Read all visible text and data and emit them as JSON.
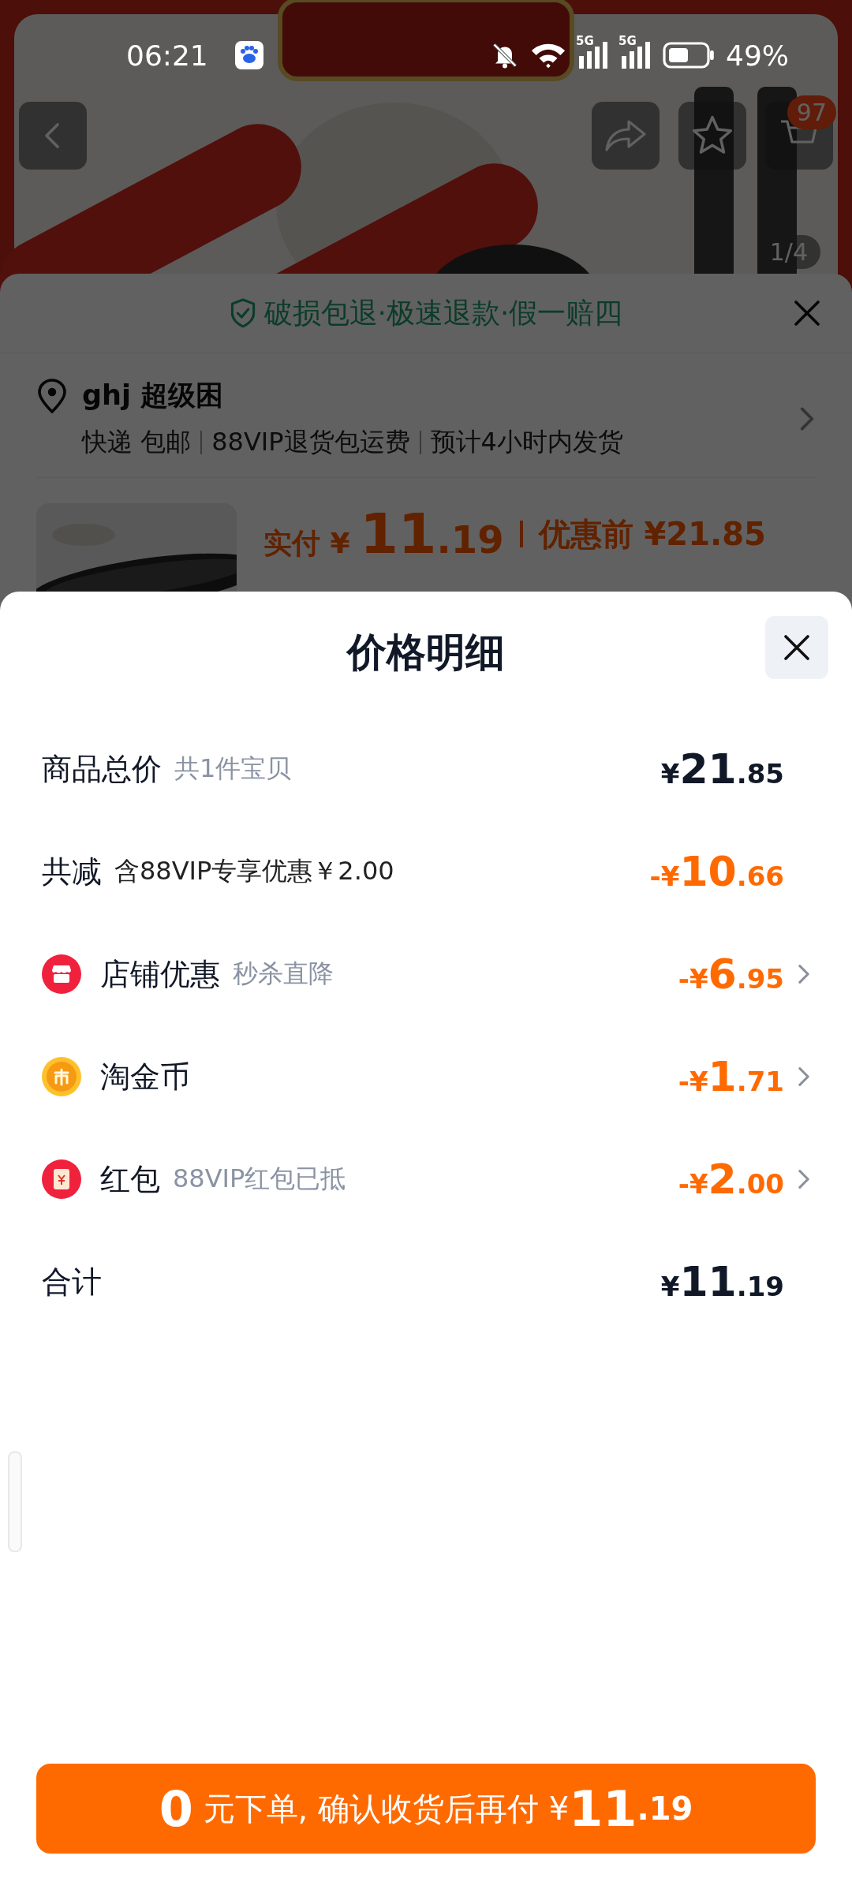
{
  "status_bar": {
    "time": "06:21",
    "networks": [
      "5G",
      "5G"
    ],
    "battery": "49%"
  },
  "product_nav": {
    "cart_badge": "97",
    "image_counter": "1/4"
  },
  "order_sheet": {
    "guarantee": "破损包退·极速退款·假一赔四",
    "address": {
      "name": "ghj 超级困",
      "details": [
        "快递 包邮",
        "88VIP退货包运费",
        "预计4小时内发货"
      ]
    },
    "price": {
      "paid": "实付 ¥ 11.19",
      "before": "优惠前 ¥21.85"
    }
  },
  "price_detail": {
    "title": "价格明细",
    "rows": [
      {
        "kind": "total",
        "label": "商品总价",
        "note": "共1件宝贝",
        "note_muted": true,
        "amount": "¥21.85",
        "chevron": false
      },
      {
        "kind": "deduction",
        "label": "共减",
        "note": "含88VIP专享优惠￥2.00",
        "note_muted": false,
        "amount": "-¥10.66",
        "chevron": false
      },
      {
        "kind": "shop_discount",
        "label": "店铺优惠",
        "note": "秒杀直降",
        "note_muted": true,
        "amount": "-¥6.95",
        "chevron": true
      },
      {
        "kind": "coin_discount",
        "label": "淘金币",
        "amount": "-¥1.71",
        "chevron": true
      },
      {
        "kind": "packet_discount",
        "label": "红包",
        "note": "88VIP红包已抵",
        "note_muted": true,
        "amount": "-¥2.00",
        "chevron": true
      },
      {
        "kind": "total",
        "label": "合计",
        "amount": "¥11.19",
        "chevron": false
      }
    ],
    "submit": "0 元下单, 确认收货后再付 ¥11.19"
  }
}
